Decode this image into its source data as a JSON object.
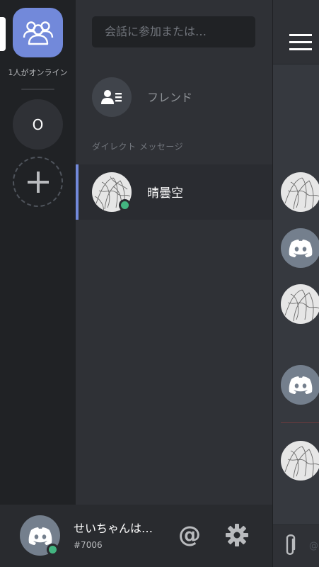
{
  "servers": {
    "online_label": "1人がオンライン",
    "server_initial": "O",
    "add_symbol": "+"
  },
  "channels": {
    "search_placeholder": "会話に参加または…",
    "friends_label": "フレンド",
    "dm_header": "ダイレクト メッセージ",
    "dm_items": [
      {
        "name": "晴曇空",
        "status": "online",
        "avatar": "sketch-avatar"
      }
    ]
  },
  "user_panel": {
    "username": "せいちゃんは…",
    "tag": "#7006",
    "status": "online",
    "mention_symbol": "@"
  },
  "chat": {
    "input_hint": "@",
    "message_avatars": [
      "sketch-avatar",
      "discord-logo-avatar",
      "sketch-avatar",
      "discord-logo-avatar",
      "sketch-avatar"
    ]
  },
  "colors": {
    "blurple": "#7289da",
    "online": "#43b581",
    "background_dark": "#202225",
    "background_mid": "#2f3136",
    "background_chat": "#36393f"
  }
}
